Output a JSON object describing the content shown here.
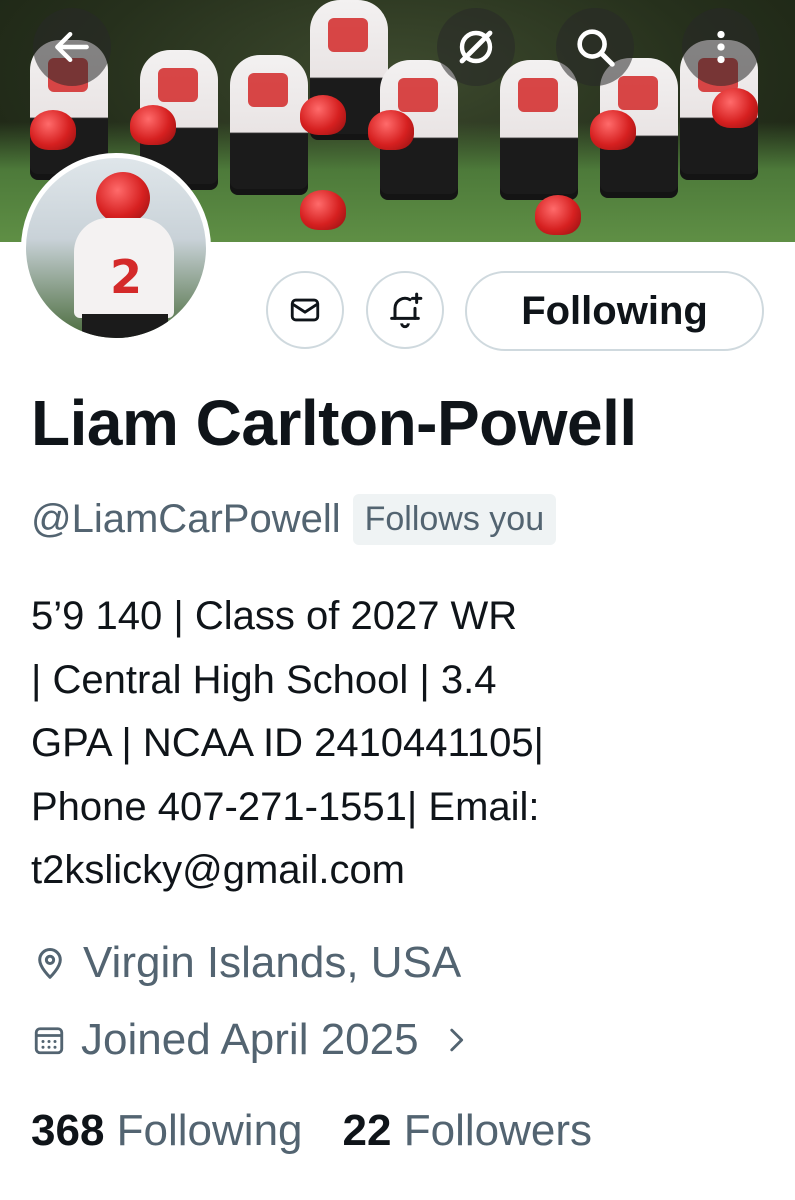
{
  "header": {
    "icons": [
      "back-arrow-icon",
      "grok-icon",
      "search-icon",
      "more-icon"
    ]
  },
  "actions": {
    "message_icon": "mail-icon",
    "notify_icon": "bell-plus-icon",
    "following_label": "Following"
  },
  "profile": {
    "name": "Liam Carlton-Powell",
    "handle": "@LiamCarPowell",
    "follows_you": "Follows you",
    "bio_lines": [
      "5’9 140 | Class of 2027 WR",
      "| Central High School | 3.4",
      "GPA | NCAA ID 2410441105|",
      "Phone 407-271-1551| Email:",
      "t2kslicky@gmail.com"
    ],
    "location": "Virgin Islands, USA",
    "joined": "Joined April 2025"
  },
  "stats": {
    "following_count": "368",
    "following_label": "Following",
    "followers_count": "22",
    "followers_label": "Followers"
  },
  "colors": {
    "text": "#0f1419",
    "secondary": "#536471",
    "border": "#cfd9de"
  }
}
